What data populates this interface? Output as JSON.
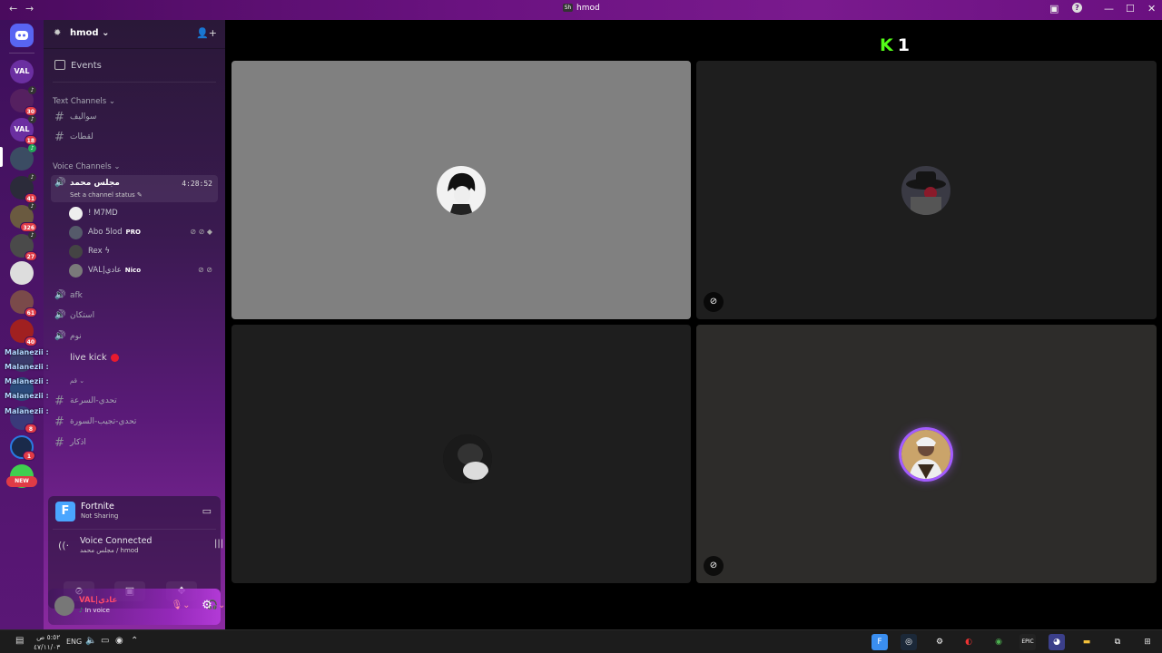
{
  "window": {
    "title": "hmod",
    "nav_back": "←",
    "nav_forward": "→",
    "inbox_icon": "inbox-icon",
    "help_icon": "?",
    "minimize": "—",
    "maximize": "☐",
    "close": "✕"
  },
  "servers": {
    "home_icon": "discord-icon",
    "badges": [
      "30",
      "18",
      "41",
      "326",
      "27",
      "61",
      "40",
      "8",
      "1"
    ],
    "new_label": "NEW"
  },
  "server": {
    "name": "hmod",
    "chevron": "⌄",
    "events_label": "Events",
    "text_category": "Text Channels",
    "voice_category": "Voice Channels",
    "text_channels": [
      "سواليف",
      "لقطات"
    ],
    "active_voice": {
      "name": "مجلس محمد",
      "timer": "4:28:52",
      "status": "Set a channel status"
    },
    "voice_users": [
      {
        "name": "! M7MD",
        "tag": ""
      },
      {
        "name": "Abo 5lod",
        "tag": "PRO"
      },
      {
        "name": "Rex ϟ",
        "tag": ""
      },
      {
        "name": "VAL|عادي",
        "tag": "Nico"
      }
    ],
    "voice_channels": [
      "afk",
      "استكان",
      "نوم"
    ],
    "live_channel": "live kick",
    "collapsed_channel": "قم",
    "more_channels": [
      "تحدي-السرعة",
      "تحدي-تجيب-السورة",
      "اذكار"
    ],
    "overlay_names": [
      "Malanezii :",
      "Malanezii :",
      "Malanezii :",
      "Malanezii :",
      "Malanezii :"
    ]
  },
  "activity": {
    "game_icon_letter": "F",
    "game": "Fortnite",
    "game_status": "Not Sharing",
    "voice_title": "Voice Connected",
    "voice_sub": "مجلس محمد / hmod"
  },
  "user": {
    "name": "VAL|عادي",
    "status": "In voice"
  },
  "main": {
    "kick_k": "K",
    "kick_count": "1"
  },
  "taskbar": {
    "time": "٥:٥٢ ص",
    "date": "٤٧/١١/٠٣",
    "lang": "ENG"
  },
  "colors": {
    "accent": "#b23ad6",
    "kick_green": "#53fc18",
    "badge_red": "#e03b46"
  }
}
